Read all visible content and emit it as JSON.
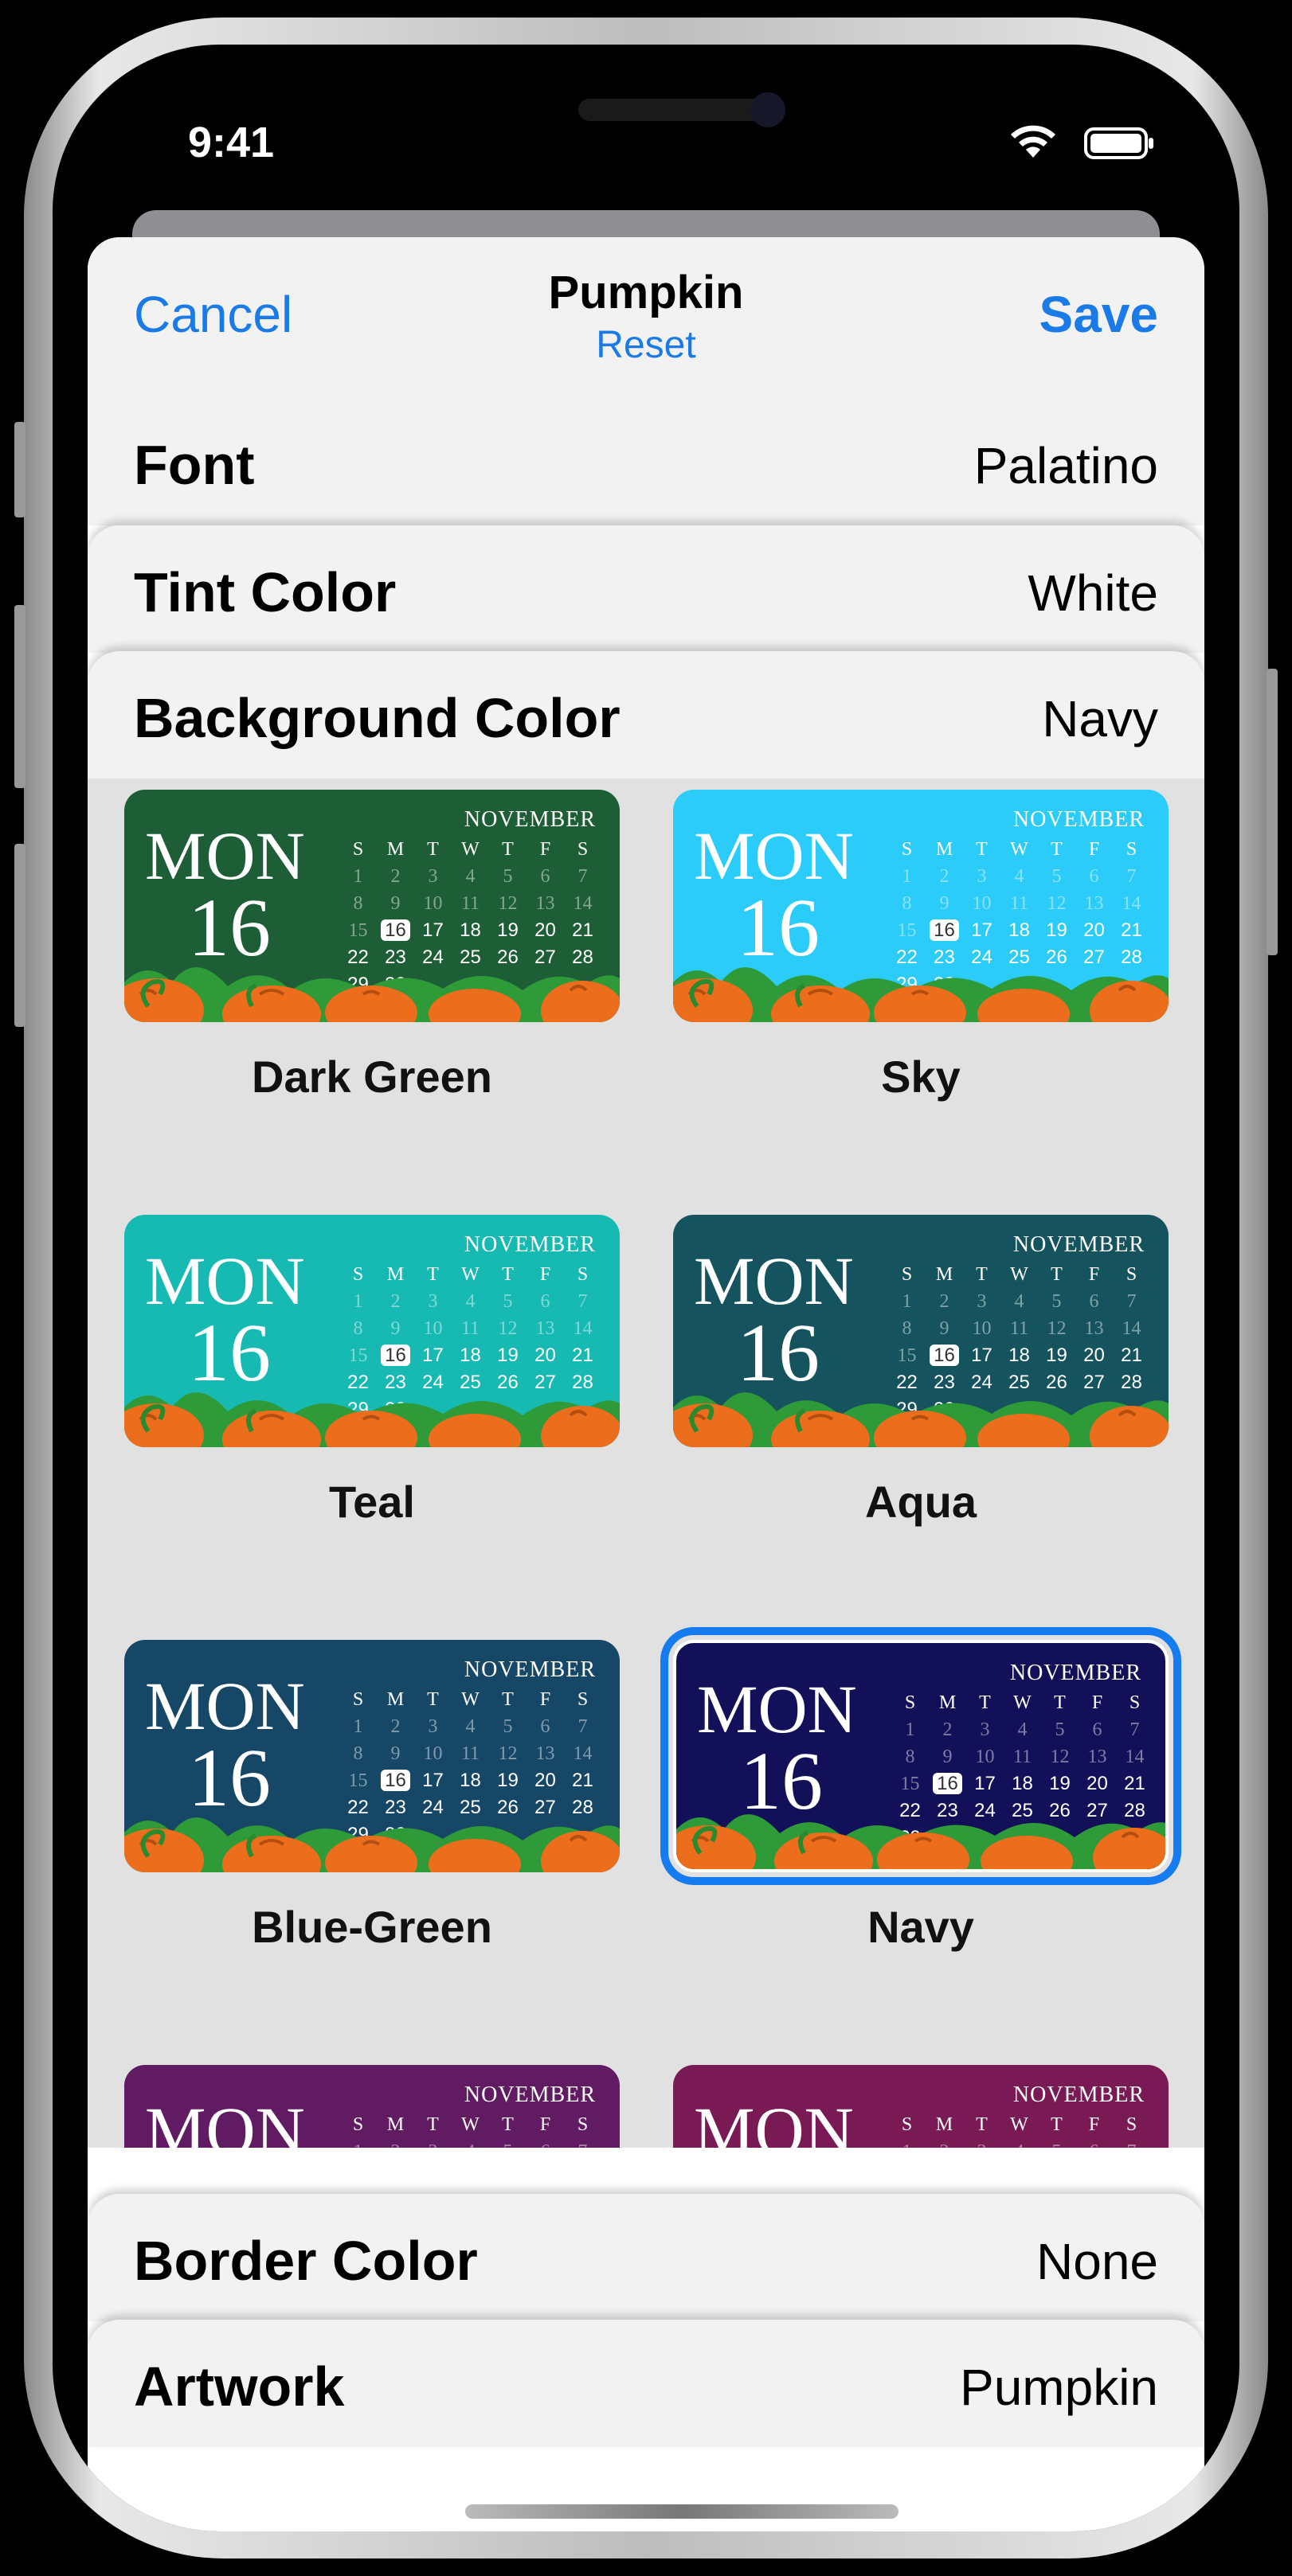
{
  "status": {
    "time": "9:41"
  },
  "nav": {
    "cancel": "Cancel",
    "title": "Pumpkin",
    "reset": "Reset",
    "save": "Save"
  },
  "settings": {
    "font": {
      "label": "Font",
      "value": "Palatino"
    },
    "tint": {
      "label": "Tint Color",
      "value": "White"
    },
    "background": {
      "label": "Background Color",
      "value": "Navy"
    },
    "border": {
      "label": "Border Color",
      "value": "None"
    },
    "artwork": {
      "label": "Artwork",
      "value": "Pumpkin"
    }
  },
  "preview": {
    "dayname": "MON",
    "daynum": "16",
    "month": "NOVEMBER",
    "weekdays": [
      "S",
      "M",
      "T",
      "W",
      "T",
      "F",
      "S"
    ],
    "weeks": [
      [
        "1",
        "2",
        "3",
        "4",
        "5",
        "6",
        "7"
      ],
      [
        "8",
        "9",
        "10",
        "11",
        "12",
        "13",
        "14"
      ],
      [
        "15",
        "16",
        "17",
        "18",
        "19",
        "20",
        "21"
      ],
      [
        "22",
        "23",
        "24",
        "25",
        "26",
        "27",
        "28"
      ],
      [
        "29",
        "30",
        "",
        "",
        "",
        "",
        ""
      ]
    ],
    "past_days": 15,
    "today": "16"
  },
  "themes": [
    {
      "name": "Dark Green",
      "color": "#1d5e36",
      "selected": false
    },
    {
      "name": "Sky",
      "color": "#2bcbfa",
      "selected": false
    },
    {
      "name": "Teal",
      "color": "#17b9b3",
      "selected": false
    },
    {
      "name": "Aqua",
      "color": "#15545e",
      "selected": false
    },
    {
      "name": "Blue-Green",
      "color": "#164767",
      "selected": false
    },
    {
      "name": "Navy",
      "color": "#121059",
      "selected": true
    },
    {
      "name": "",
      "color": "#611b63",
      "selected": false
    },
    {
      "name": "",
      "color": "#7a1a54",
      "selected": false
    }
  ],
  "colors": {
    "accent": "#1a7ae8",
    "selection": "#147cf0",
    "pumpkin": "#ec6e1c",
    "leaf": "#2e9a38"
  }
}
